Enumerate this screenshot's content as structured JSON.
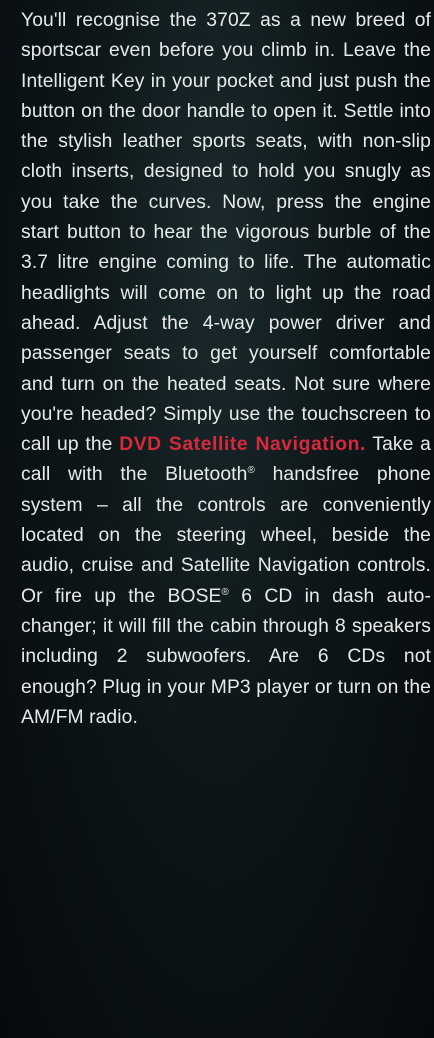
{
  "article": {
    "p1": "You'll recognise the 370Z as a new breed of sportscar even before you climb in. Leave the Intelligent Key in your pocket and just push the button on the door handle to open it. Settle into the stylish leather sports seats, with non-slip cloth inserts, designed to hold you snugly as you take the curves. Now, press the engine start button to hear the vigorous burble of the 3.7 litre engine coming to life. The automatic headlights will come on to light up the road ahead. Adjust the 4-way power driver and passenger seats to get yourself comfortable and turn on the heated seats. Not sure where you're headed? Simply use the touchscreen to call up the",
    "highlight": "DVD Satellite Navigation.",
    "p2": "Take a call with the Bluetooth",
    "reg1": "®",
    "p3": "handsfree phone system – all the controls are conveniently located on the steering wheel, beside the audio, cruise and Satellite Navigation controls. Or fire up the BOSE",
    "reg2": "®",
    "p4": "6 CD in dash auto-changer; it will fill the cabin through 8 speakers including 2 subwoofers. Are 6 CDs not enough? Plug in your MP3 player or turn on the AM/FM radio."
  }
}
